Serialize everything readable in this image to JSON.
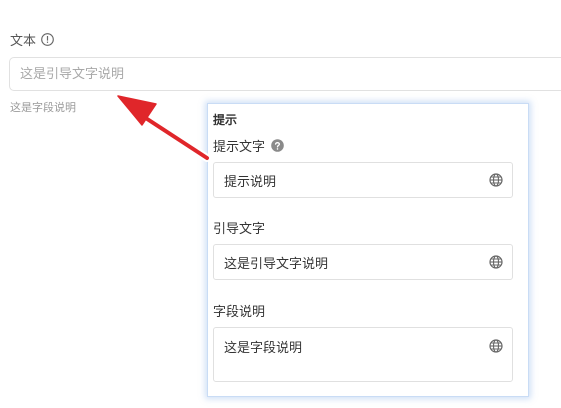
{
  "field": {
    "label": "文本",
    "placeholder": "这是引导文字说明",
    "help_text": "这是字段说明"
  },
  "panel": {
    "title": "提示",
    "tooltip": {
      "label": "提示文字",
      "value": "提示说明"
    },
    "placeholder": {
      "label": "引导文字",
      "value": "这是引导文字说明"
    },
    "description": {
      "label": "字段说明",
      "value": "这是字段说明"
    }
  },
  "icons": {
    "info": "info-circle-icon",
    "help": "question-circle-icon",
    "globe": "globe-icon",
    "arrow": "red-arrow"
  },
  "colors": {
    "arrow": "#e0262a",
    "panel_border": "#c9dcf5",
    "icon_gray": "#8a8a8a"
  }
}
